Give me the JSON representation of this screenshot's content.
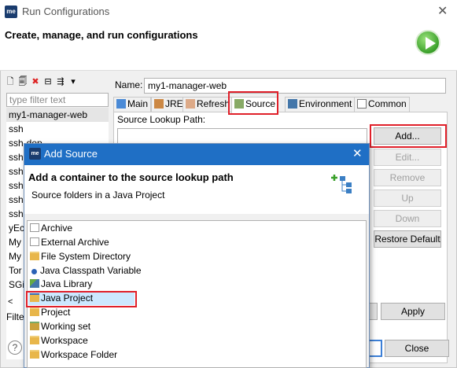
{
  "window": {
    "title": "Run Configurations",
    "header_title": "Create, manage, and run configurations",
    "close_glyph": "✕",
    "icon_text": "me"
  },
  "left": {
    "filter_placeholder": "type filter text",
    "items": [
      "my1-manager-web",
      "ssh",
      "ssh-dep",
      "ssh",
      "ssh",
      "ssh",
      "ssh",
      "ssh",
      "yEcl",
      "My",
      "My",
      "Tor",
      "SGi I"
    ],
    "footer_label": "Filte"
  },
  "config": {
    "name_label": "Name:",
    "name_value": "my1-manager-web",
    "tabs": [
      "Main",
      "JRE",
      "Refresh",
      "Source",
      "Environment",
      "Common"
    ],
    "source_label": "Source Lookup Path:",
    "buttons": {
      "add": "Add...",
      "edit": "Edit...",
      "remove": "Remove",
      "up": "Up",
      "down": "Down",
      "restore": "Restore Default"
    },
    "apply": "Apply",
    "close": "Close"
  },
  "dialog": {
    "title": "Add Source",
    "icon_text": "me",
    "close_glyph": "✕",
    "heading": "Add a container to the source lookup path",
    "subheading": "Source folders in a Java Project",
    "items": [
      "Archive",
      "External Archive",
      "File System Directory",
      "Java Classpath Variable",
      "Java Library",
      "Java Project",
      "Project",
      "Working set",
      "Workspace",
      "Workspace Folder"
    ],
    "selected": "Java Project"
  },
  "colors": {
    "highlight_box": "#e0202a",
    "dialog_title_bg": "#1f6fc5",
    "selection": "#cce8ff"
  }
}
